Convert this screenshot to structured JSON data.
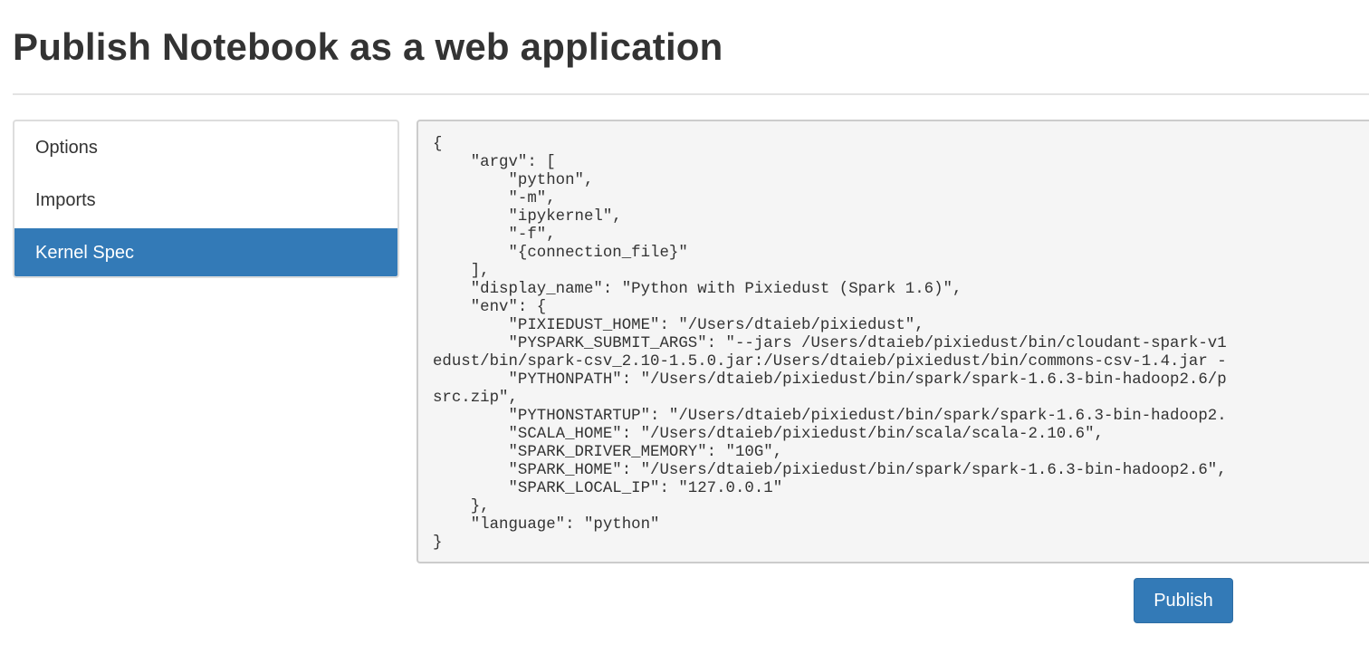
{
  "page": {
    "title": "Publish Notebook as a web application"
  },
  "nav": {
    "items": [
      {
        "label": "Options",
        "active": false
      },
      {
        "label": "Imports",
        "active": false
      },
      {
        "label": "Kernel Spec",
        "active": true
      }
    ]
  },
  "kernel_spec": {
    "lines": [
      "{",
      "    \"argv\": [",
      "        \"python\",",
      "        \"-m\",",
      "        \"ipykernel\",",
      "        \"-f\",",
      "        \"{connection_file}\"",
      "    ],",
      "    \"display_name\": \"Python with Pixiedust (Spark 1.6)\",",
      "    \"env\": {",
      "        \"PIXIEDUST_HOME\": \"/Users/dtaieb/pixiedust\",",
      "        \"PYSPARK_SUBMIT_ARGS\": \"--jars /Users/dtaieb/pixiedust/bin/cloudant-spark-v1",
      "edust/bin/spark-csv_2.10-1.5.0.jar:/Users/dtaieb/pixiedust/bin/commons-csv-1.4.jar -",
      "        \"PYTHONPATH\": \"/Users/dtaieb/pixiedust/bin/spark/spark-1.6.3-bin-hadoop2.6/p",
      "src.zip\",",
      "        \"PYTHONSTARTUP\": \"/Users/dtaieb/pixiedust/bin/spark/spark-1.6.3-bin-hadoop2.",
      "        \"SCALA_HOME\": \"/Users/dtaieb/pixiedust/bin/scala/scala-2.10.6\",",
      "        \"SPARK_DRIVER_MEMORY\": \"10G\",",
      "        \"SPARK_HOME\": \"/Users/dtaieb/pixiedust/bin/spark/spark-1.6.3-bin-hadoop2.6\",",
      "        \"SPARK_LOCAL_IP\": \"127.0.0.1\"",
      "    },",
      "    \"language\": \"python\"",
      "}"
    ]
  },
  "actions": {
    "publish_label": "Publish"
  },
  "colors": {
    "primary": "#337ab7",
    "code_background": "#f5f5f5"
  }
}
